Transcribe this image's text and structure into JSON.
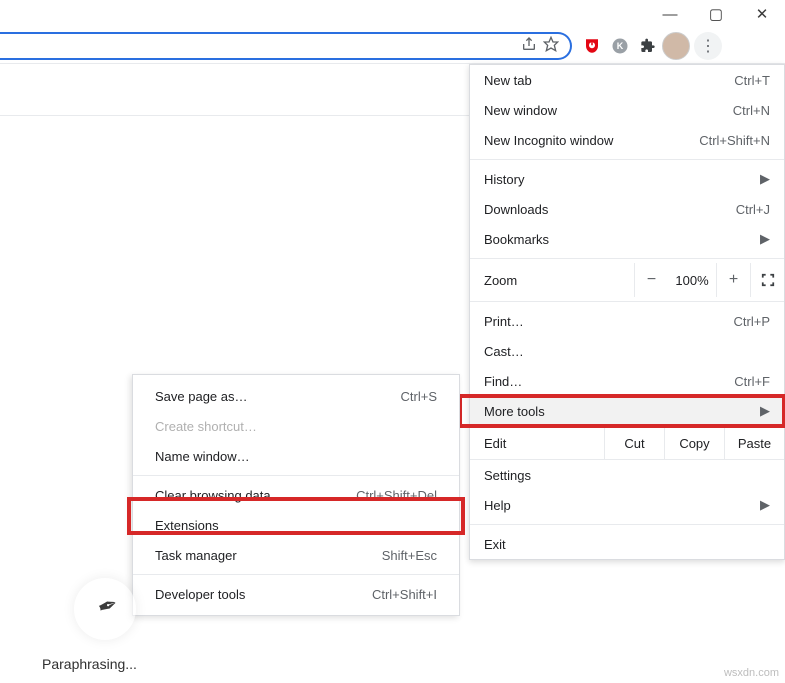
{
  "window_controls": {
    "minimize_glyph": "—",
    "maximize_glyph": "▢",
    "close_glyph": "✕"
  },
  "toolbar": {
    "share_icon": "share-icon",
    "star_icon": "star-icon",
    "kebab_glyph": "⋮"
  },
  "menu": {
    "new_tab": {
      "label": "New tab",
      "shortcut": "Ctrl+T"
    },
    "new_window": {
      "label": "New window",
      "shortcut": "Ctrl+N"
    },
    "new_incognito": {
      "label": "New Incognito window",
      "shortcut": "Ctrl+Shift+N"
    },
    "history": {
      "label": "History",
      "shortcut": ""
    },
    "downloads": {
      "label": "Downloads",
      "shortcut": "Ctrl+J"
    },
    "bookmarks": {
      "label": "Bookmarks",
      "shortcut": ""
    },
    "zoom": {
      "label": "Zoom",
      "value": "100%",
      "minus": "−",
      "plus": "+"
    },
    "print": {
      "label": "Print…",
      "shortcut": "Ctrl+P"
    },
    "cast": {
      "label": "Cast…",
      "shortcut": ""
    },
    "find": {
      "label": "Find…",
      "shortcut": "Ctrl+F"
    },
    "more_tools": {
      "label": "More tools"
    },
    "edit": {
      "label": "Edit",
      "cut": "Cut",
      "copy": "Copy",
      "paste": "Paste"
    },
    "settings": {
      "label": "Settings"
    },
    "help": {
      "label": "Help"
    },
    "exit": {
      "label": "Exit"
    }
  },
  "submenu": {
    "save_page": {
      "label": "Save page as…",
      "shortcut": "Ctrl+S"
    },
    "create_shortcut": {
      "label": "Create shortcut…"
    },
    "name_window": {
      "label": "Name window…"
    },
    "clear_data": {
      "label": "Clear browsing data…",
      "shortcut": "Ctrl+Shift+Del"
    },
    "extensions": {
      "label": "Extensions"
    },
    "task_manager": {
      "label": "Task manager",
      "shortcut": "Shift+Esc"
    },
    "developer_tools": {
      "label": "Developer tools",
      "shortcut": "Ctrl+Shift+I"
    }
  },
  "caption": "Paraphrasing...",
  "watermark": "wsxdn.com"
}
